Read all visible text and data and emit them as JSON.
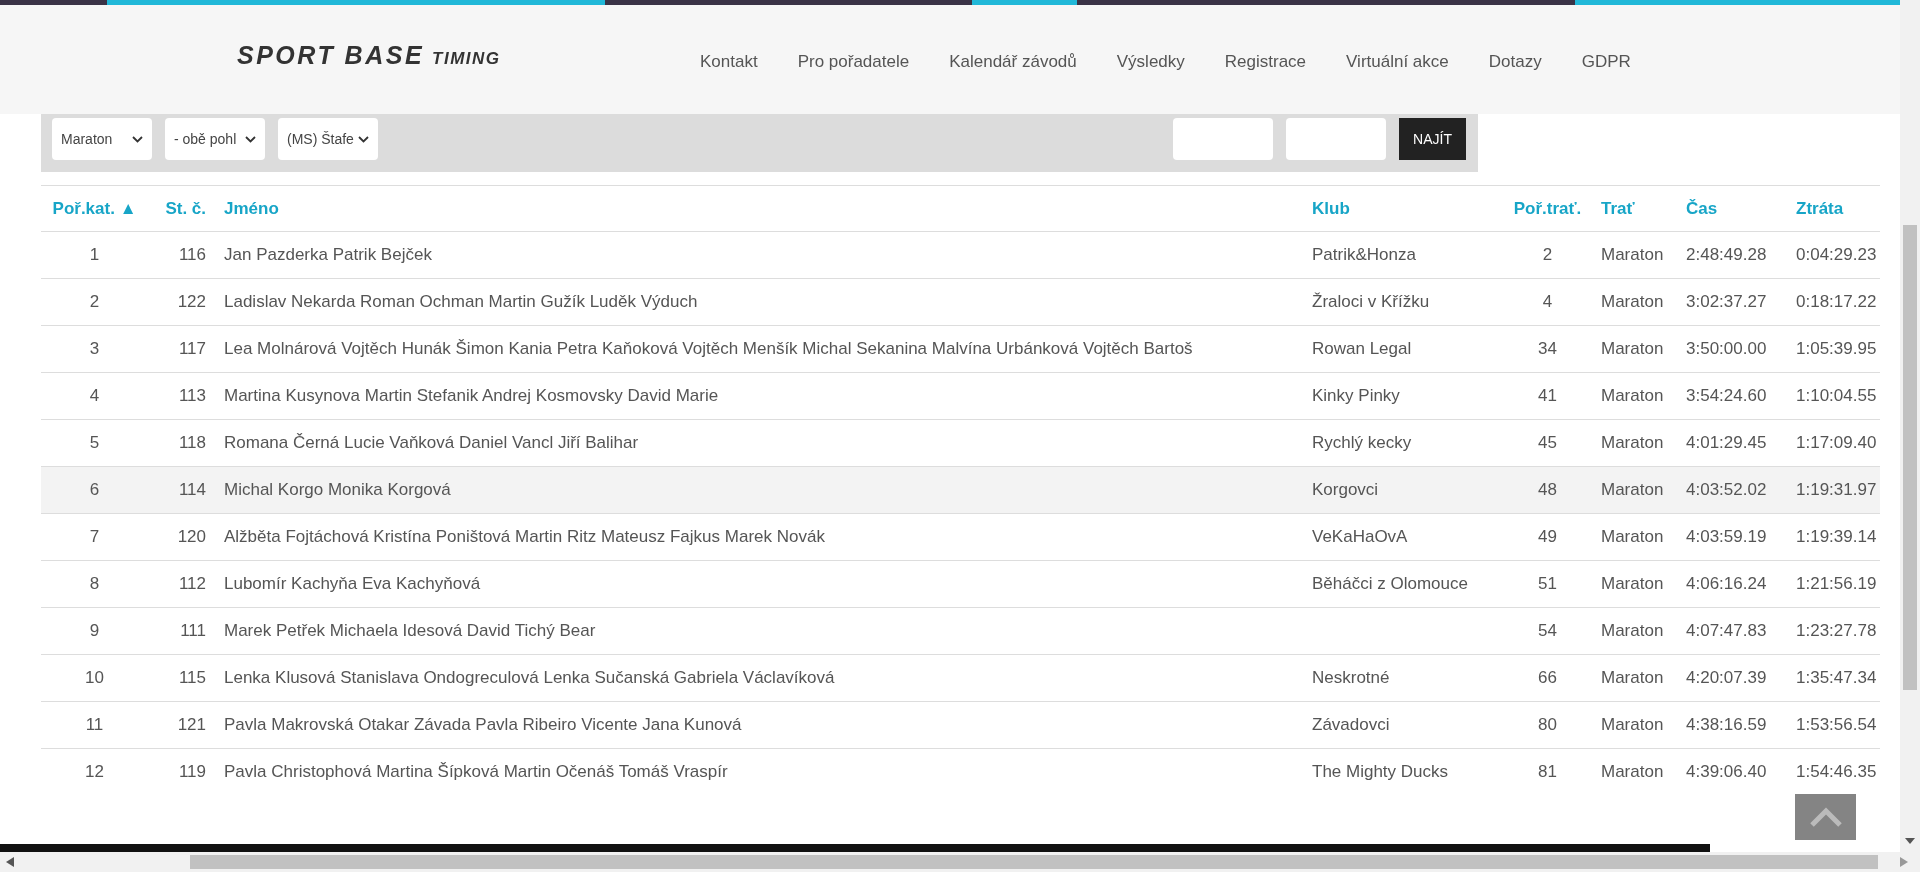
{
  "progress": {
    "level": 0.9
  },
  "header": {
    "logo": {
      "main": "SPORT BASE",
      "sub": "TIMING"
    },
    "nav": [
      "Kontakt",
      "Pro pořadatele",
      "Kalendář závodů",
      "Výsledky",
      "Registrace",
      "Virtuální akce",
      "Dotazy",
      "GDPR"
    ]
  },
  "filters": {
    "selects": [
      "Maraton",
      "- obě pohl",
      "(MS) Štafe"
    ],
    "button": "NAJÍT"
  },
  "table": {
    "columns": [
      "Poř.kat. ▲",
      "St. č.",
      "Jméno",
      "Klub",
      "Poř.trať.",
      "Trať",
      "Čas",
      "Ztráta"
    ],
    "rows": [
      {
        "rank": "1",
        "bib": "116",
        "name": "Jan Pazderka Patrik Bejček",
        "club": "Patrik&Honza",
        "track_rank": "2",
        "track": "Maraton",
        "time": "2:48:49.28",
        "loss": "0:04:29.23",
        "highlighted": false
      },
      {
        "rank": "2",
        "bib": "122",
        "name": "Ladislav Nekarda Roman Ochman Martin Gužík Luděk Výduch",
        "club": "Žraloci v Křížku",
        "track_rank": "4",
        "track": "Maraton",
        "time": "3:02:37.27",
        "loss": "0:18:17.22",
        "highlighted": false
      },
      {
        "rank": "3",
        "bib": "117",
        "name": "Lea Molnárová Vojtěch Hunák Šimon Kania Petra Kaňoková Vojtěch Menšík Michal Sekanina Malvína Urbánková Vojtěch Bartoš",
        "club": "Rowan Legal",
        "track_rank": "34",
        "track": "Maraton",
        "time": "3:50:00.00",
        "loss": "1:05:39.95",
        "highlighted": false
      },
      {
        "rank": "4",
        "bib": "113",
        "name": "Martina Kusynova Martin Stefanik Andrej Kosmovsky David Marie",
        "club": "Kinky Pinky",
        "track_rank": "41",
        "track": "Maraton",
        "time": "3:54:24.60",
        "loss": "1:10:04.55",
        "highlighted": false
      },
      {
        "rank": "5",
        "bib": "118",
        "name": "Romana Černá Lucie Vaňková Daniel Vancl Jiří Balihar",
        "club": "Rychlý kecky",
        "track_rank": "45",
        "track": "Maraton",
        "time": "4:01:29.45",
        "loss": "1:17:09.40",
        "highlighted": false
      },
      {
        "rank": "6",
        "bib": "114",
        "name": "Michal Korgo Monika Korgová",
        "club": "Korgovci",
        "track_rank": "48",
        "track": "Maraton",
        "time": "4:03:52.02",
        "loss": "1:19:31.97",
        "highlighted": true
      },
      {
        "rank": "7",
        "bib": "120",
        "name": "Alžběta Fojtáchová Kristína Poništová Martin Ritz Mateusz Fajkus Marek Novák",
        "club": "VeKaHaOvA",
        "track_rank": "49",
        "track": "Maraton",
        "time": "4:03:59.19",
        "loss": "1:19:39.14",
        "highlighted": false
      },
      {
        "rank": "8",
        "bib": "112",
        "name": "Lubomír Kachyňa Eva Kachyňová",
        "club": "Běháčci z Olomouce",
        "track_rank": "51",
        "track": "Maraton",
        "time": "4:06:16.24",
        "loss": "1:21:56.19",
        "highlighted": false
      },
      {
        "rank": "9",
        "bib": "111",
        "name": "Marek Petřek Michaela Idesová David Tichý Bear",
        "track_rank": "54",
        "track": "Maraton",
        "time": "4:07:47.83",
        "loss": "1:23:27.78",
        "highlighted": false
      },
      {
        "rank": "10",
        "bib": "115",
        "name": "Lenka Klusová Stanislava Ondogreculová Lenka Sučanská Gabriela Václavíková",
        "club": "Neskrotné",
        "track_rank": "66",
        "track": "Maraton",
        "time": "4:20:07.39",
        "loss": "1:35:47.34",
        "highlighted": false
      },
      {
        "rank": "11",
        "bib": "121",
        "name": "Pavla Makrovská Otakar Závada Pavla Ribeiro Vicente Jana Kunová",
        "club": "Závadovci",
        "track_rank": "80",
        "track": "Maraton",
        "time": "4:38:16.59",
        "loss": "1:53:56.54",
        "highlighted": false
      },
      {
        "rank": "12",
        "bib": "119",
        "name": "Pavla Christophová Martina Šípková Martin Očenáš Tomáš Vraspír",
        "club": "The Mighty Ducks",
        "track_rank": "81",
        "track": "Maraton",
        "time": "4:39:06.40",
        "loss": "1:54:46.35",
        "highlighted": false
      }
    ]
  }
}
